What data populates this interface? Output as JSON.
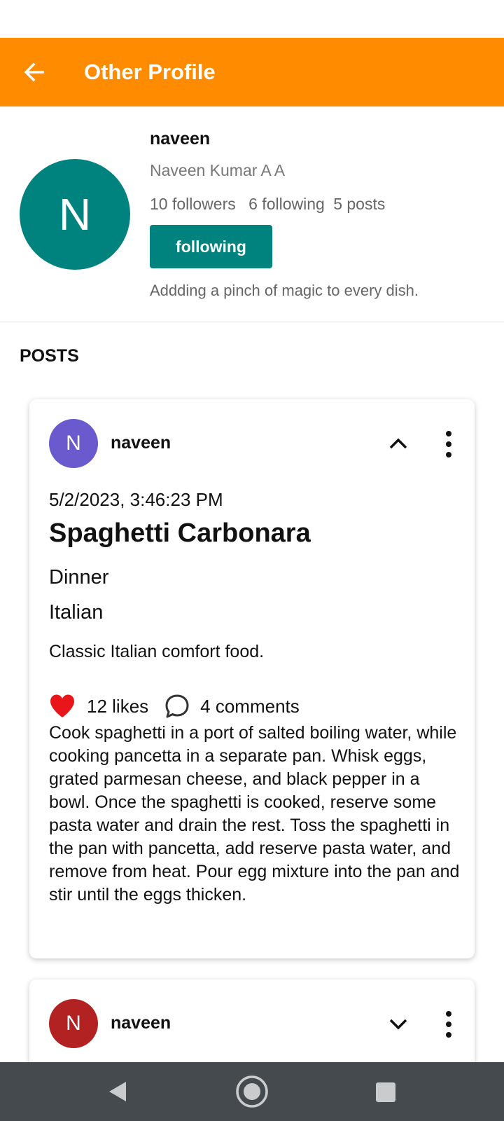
{
  "app_bar": {
    "title": "Other Profile",
    "back_icon": "arrow-left-icon",
    "color": "#ff8c00"
  },
  "profile": {
    "avatar_letter": "N",
    "avatar_color": "#00827f",
    "username": "naveen",
    "full_name": "Naveen Kumar A A",
    "followers": "10 followers",
    "following": "6 following",
    "posts": "5 posts",
    "follow_button_label": "following",
    "bio": "Addding a pinch of magic to every dish."
  },
  "posts_heading": "POSTS",
  "posts": [
    {
      "avatar_letter": "N",
      "avatar_color": "#6a5acd",
      "username": "naveen",
      "expand_icon": "chevron-up-icon",
      "menu_icon": "more-vertical-icon",
      "date": "5/2/2023, 3:46:23 PM",
      "title": "Spaghetti Carbonara",
      "meal": "Dinner",
      "cuisine": "Italian",
      "description": "Classic Italian comfort food.",
      "likes": "12 likes",
      "comments": "4 comments",
      "liked": true,
      "recipe": "Cook spaghetti in a port of salted boiling water, while cooking pancetta in a separate pan. Whisk eggs, grated parmesan cheese, and black pepper in a bowl. Once the spaghetti is cooked, reserve some pasta water and drain the rest. Toss the spaghetti in the pan with pancetta, add reserve pasta water, and remove from heat. Pour egg mixture into the pan and stir until the eggs thicken."
    },
    {
      "avatar_letter": "N",
      "avatar_color": "#b22222",
      "username": "naveen",
      "expand_icon": "chevron-down-icon",
      "menu_icon": "more-vertical-icon"
    }
  ],
  "nav_bar": {
    "back_icon": "triangle-back-icon",
    "home_icon": "circle-home-icon",
    "recents_icon": "square-recents-icon"
  }
}
